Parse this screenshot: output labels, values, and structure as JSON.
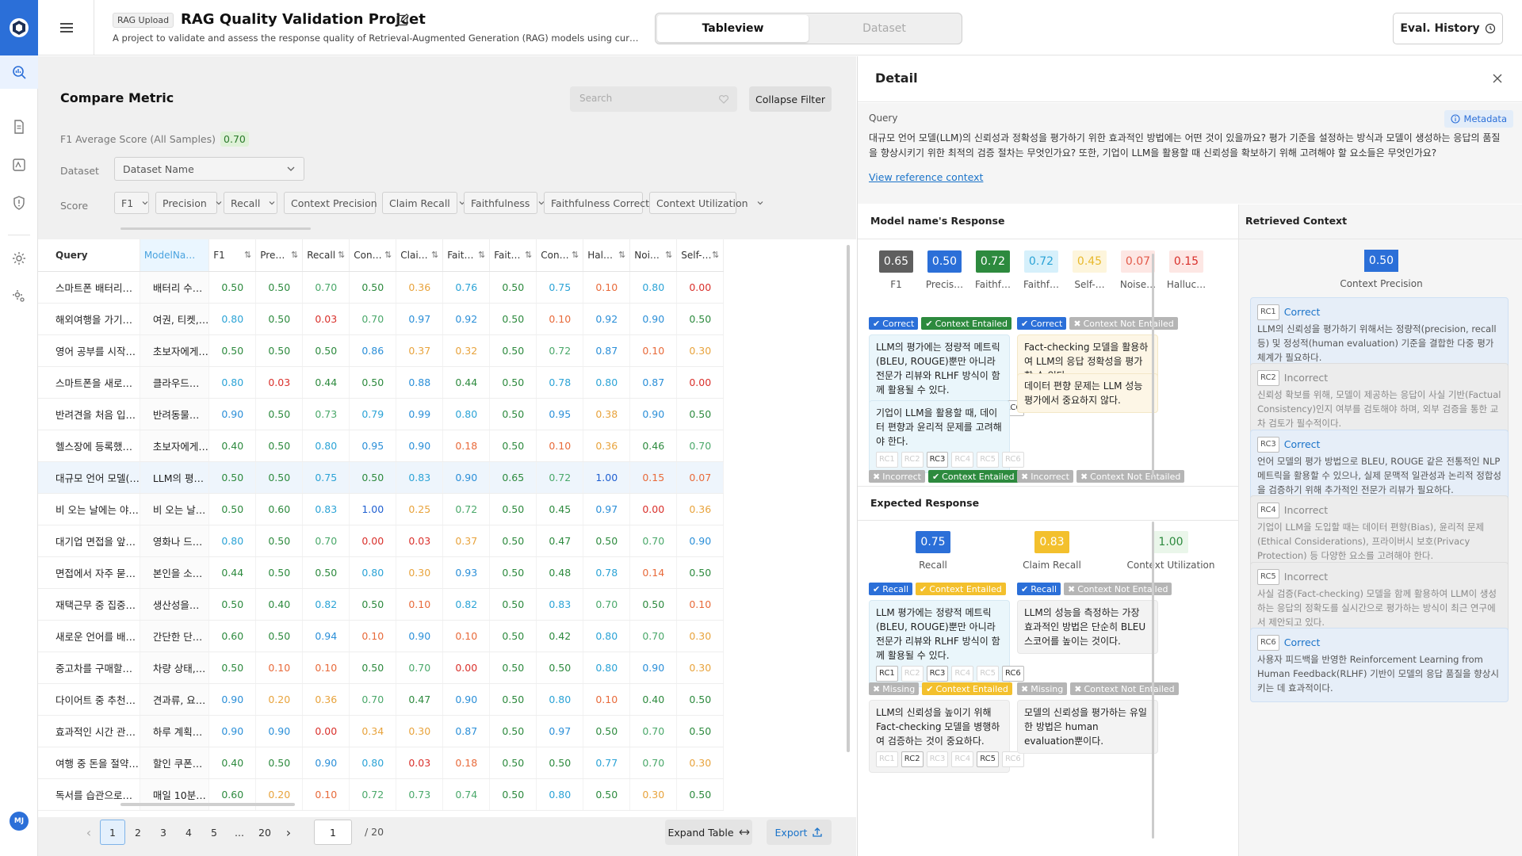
{
  "app": {
    "user_initials": "MJ"
  },
  "header": {
    "tag": "RAG Upload",
    "title": "RAG Quality Validation Projcet",
    "description": "A project to validate and assess the response quality of Retrieval-Augmented Generation (RAG) models using curated…",
    "tabs": [
      "Tableview",
      "Dataset"
    ],
    "eval_history": "Eval. History"
  },
  "compare": {
    "title": "Compare Metric",
    "search_placeholder": "Search",
    "collapse_filter": "Collapse Filter",
    "f1_label": "F1 Average Score (All Samples)",
    "f1_value": "0.70",
    "dataset_label": "Dataset",
    "dataset_value": "Dataset Name",
    "score_label": "Score",
    "filters": [
      "F1",
      "Precision",
      "Recall",
      "Context Precision",
      "Claim Recall",
      "Faithfulness",
      "Faithfulness Correct",
      "Context Utilization"
    ]
  },
  "table": {
    "headers": [
      "Query",
      "ModelNa…",
      "F1",
      "Pre…",
      "Recall",
      "Con…",
      "Clai…",
      "Fait…",
      "Fait…",
      "Con…",
      "Hal…",
      "Noi…",
      "Self-…"
    ],
    "rows": [
      {
        "q": "스마트폰 배터리…",
        "m": "배터리 수…",
        "v": [
          "0.50",
          "0.50",
          "0.70",
          "0.50",
          "0.36",
          "0.76",
          "0.50",
          "0.75",
          "0.10",
          "0.80",
          "0.00"
        ]
      },
      {
        "q": "해외여행을 가기…",
        "m": "여권, 티켓,…",
        "v": [
          "0.80",
          "0.50",
          "0.03",
          "0.70",
          "0.97",
          "0.92",
          "0.50",
          "0.10",
          "0.92",
          "0.90",
          "0.50"
        ]
      },
      {
        "q": "영어 공부를 시작…",
        "m": "초보자에게…",
        "v": [
          "0.50",
          "0.50",
          "0.50",
          "0.86",
          "0.37",
          "0.32",
          "0.50",
          "0.72",
          "0.87",
          "0.10",
          "0.30"
        ]
      },
      {
        "q": "스마트폰을 새로…",
        "m": "클라우드…",
        "v": [
          "0.80",
          "0.03",
          "0.44",
          "0.50",
          "0.88",
          "0.44",
          "0.50",
          "0.78",
          "0.80",
          "0.87",
          "0.00"
        ]
      },
      {
        "q": "반려견을 처음 입…",
        "m": "반려동물…",
        "v": [
          "0.90",
          "0.50",
          "0.73",
          "0.79",
          "0.99",
          "0.80",
          "0.50",
          "0.95",
          "0.38",
          "0.90",
          "0.50"
        ]
      },
      {
        "q": "헬스장에 등록했…",
        "m": "초보자에게…",
        "v": [
          "0.40",
          "0.50",
          "0.80",
          "0.95",
          "0.90",
          "0.18",
          "0.50",
          "0.10",
          "0.36",
          "0.46",
          "0.70"
        ]
      },
      {
        "q": "대규모 언어 모델(…",
        "m": "LLM의 평…",
        "v": [
          "0.50",
          "0.50",
          "0.75",
          "0.50",
          "0.83",
          "0.90",
          "0.65",
          "0.72",
          "1.00",
          "0.15",
          "0.07"
        ]
      },
      {
        "q": "비 오는 날에는 야…",
        "m": "비 오는 날…",
        "v": [
          "0.50",
          "0.60",
          "0.83",
          "1.00",
          "0.25",
          "0.72",
          "0.50",
          "0.45",
          "0.97",
          "0.00",
          "0.36"
        ]
      },
      {
        "q": "대기업 면접을 앞…",
        "m": "영화나 드…",
        "v": [
          "0.80",
          "0.50",
          "0.70",
          "0.00",
          "0.03",
          "0.37",
          "0.50",
          "0.47",
          "0.50",
          "0.70",
          "0.90"
        ]
      },
      {
        "q": "면접에서 자주 묻…",
        "m": "본인을 소…",
        "v": [
          "0.44",
          "0.50",
          "0.50",
          "0.80",
          "0.30",
          "0.93",
          "0.50",
          "0.48",
          "0.78",
          "0.14",
          "0.50"
        ]
      },
      {
        "q": "재택근무 중 집중…",
        "m": "생산성을…",
        "v": [
          "0.50",
          "0.40",
          "0.82",
          "0.50",
          "0.10",
          "0.82",
          "0.50",
          "0.83",
          "0.70",
          "0.50",
          "0.10"
        ]
      },
      {
        "q": "새로운 언어를 배…",
        "m": "간단한 단…",
        "v": [
          "0.60",
          "0.50",
          "0.94",
          "0.10",
          "0.90",
          "0.10",
          "0.50",
          "0.42",
          "0.80",
          "0.70",
          "0.30"
        ]
      },
      {
        "q": "중고차를 구매할…",
        "m": "차량 상태,…",
        "v": [
          "0.50",
          "0.10",
          "0.10",
          "0.50",
          "0.70",
          "0.00",
          "0.50",
          "0.50",
          "0.80",
          "0.90",
          "0.30"
        ]
      },
      {
        "q": "다이어트 중 추천…",
        "m": "견과류, 요…",
        "v": [
          "0.90",
          "0.20",
          "0.36",
          "0.70",
          "0.47",
          "0.90",
          "0.50",
          "0.80",
          "0.10",
          "0.40",
          "0.50"
        ]
      },
      {
        "q": "효과적인 시간 관…",
        "m": "하루 계획…",
        "v": [
          "0.90",
          "0.90",
          "0.00",
          "0.34",
          "0.30",
          "0.87",
          "0.50",
          "0.97",
          "0.50",
          "0.70",
          "0.50"
        ]
      },
      {
        "q": "여행 중 돈을 절약…",
        "m": "할인 쿠폰…",
        "v": [
          "0.40",
          "0.50",
          "0.90",
          "0.80",
          "0.03",
          "0.18",
          "0.50",
          "0.50",
          "0.77",
          "0.70",
          "0.30"
        ]
      },
      {
        "q": "독서를 습관으로…",
        "m": "매일 10분…",
        "v": [
          "0.60",
          "0.20",
          "0.10",
          "0.72",
          "0.73",
          "0.74",
          "0.50",
          "0.80",
          "0.50",
          "0.30",
          "0.50"
        ]
      }
    ]
  },
  "pagination": {
    "pages": [
      "1",
      "2",
      "3",
      "4",
      "5",
      "...",
      "20"
    ],
    "current": "1",
    "total": "/ 20",
    "expand": "Expand Table",
    "export": "Export"
  },
  "detail": {
    "title": "Detail",
    "query_label": "Query",
    "metadata": "Metadata",
    "query_text": "대규모 언어 모델(LLM)의 신뢰성과 정확성을 평가하기 위한 효과적인 방법에는 어떤 것이 있을까요? 평가 기준을 설정하는 방식과 모델이 생성하는 응답의 품질을 향상시키기 위한 최적의 검증 절차는 무엇인가요? 또한, 기업이 LLM을 활용할 때 신뢰성을 확보하기 위해 고려해야 할 요소들은 무엇인가요?",
    "view_ref": "View reference context",
    "model_resp_title": "Model name's Response",
    "model_metrics": [
      {
        "v": "0.65",
        "n": "F1",
        "bg": "#5f5f5f",
        "fg": "#ffffff"
      },
      {
        "v": "0.50",
        "n": "Precis…",
        "bg": "#2b6fd8",
        "fg": "#ffffff"
      },
      {
        "v": "0.72",
        "n": "Faithf…",
        "bg": "#2d8a3e",
        "fg": "#ffffff"
      },
      {
        "v": "0.72",
        "n": "Faithf…",
        "bg": "#d6f0fb",
        "fg": "#2ba3d6"
      },
      {
        "v": "0.45",
        "n": "Self-…",
        "bg": "#fdf5dc",
        "fg": "#e8b92c"
      },
      {
        "v": "0.07",
        "n": "Noise…",
        "bg": "#fde7e4",
        "fg": "#e35a4a"
      },
      {
        "v": "0.15",
        "n": "Halluc…",
        "bg": "#fde7e4",
        "fg": "#d9302b"
      }
    ],
    "tags": {
      "correct": "Correct",
      "incorrect": "Incorrect",
      "ctx_ent": "Context Entailed",
      "ctx_not": "Context Not Entailed",
      "recall": "Recall",
      "missing": "Missing"
    },
    "claims_left": [
      {
        "text": "LLM의 평가에는 정량적 메트릭(BLEU, ROUGE)뿐만 아니라 전문가 리뷰와 RLHF 방식이 함께 활용될 수 있다.",
        "rcs": [
          "RC1",
          "RC2",
          "RC3",
          "RC4",
          "RC5",
          "RC6"
        ]
      },
      {
        "text": "기업이 LLM을 활용할 때, 데이터 편향과 윤리적 문제를 고려해야 한다.",
        "rcs": [
          "RC1",
          "RC2",
          "RC3",
          "RC4",
          "RC5",
          "RC6"
        ]
      }
    ],
    "claims_right": [
      {
        "text": "Fact-checking 모델을 활용하여 LLM의 응답 정확성을 평가할 수 있다."
      },
      {
        "text": "데이터 편향 문제는 LLM 성능 평가에서 중요하지 않다."
      }
    ],
    "expected_title": "Expected Response",
    "expected_metrics": [
      {
        "v": "0.75",
        "n": "Recall",
        "bg": "#2b6fd8",
        "fg": "#ffffff"
      },
      {
        "v": "0.83",
        "n": "Claim Recall",
        "bg": "#f3c02d",
        "fg": "#ffffff"
      },
      {
        "v": "1.00",
        "n": "Context Utilization",
        "bg": "#eaf6ea",
        "fg": "#2d8a3e"
      }
    ],
    "exp_left": [
      {
        "text": "LLM 평가에는 정량적 메트릭(BLEU, ROUGE)뿐만 아니라 전문가 리뷰와 RLHF 방식이 함께 활용될 수 있다.",
        "rcs": [
          "RC1",
          "RC2",
          "RC3",
          "RC4",
          "RC5",
          "RC6"
        ]
      },
      {
        "text": "LLM의 신뢰성을 높이기 위해 Fact-checking 모델을 병행하여 검증하는 것이 중요하다.",
        "rcs": [
          "RC1",
          "RC2",
          "RC3",
          "RC4",
          "RC5",
          "RC6"
        ]
      }
    ],
    "exp_right": [
      {
        "text": "LLM의 성능을 측정하는 가장 효과적인 방법은 단순히 BLEU 스코어를 높이는 것이다."
      },
      {
        "text": "모델의 신뢰성을 평가하는 유일한 방법은 human evaluation뿐이다."
      }
    ],
    "retrieved_title": "Retrieved Context",
    "context_precision": {
      "v": "0.50",
      "n": "Context Precision"
    },
    "contexts": [
      {
        "id": "RC1",
        "label": "Correct",
        "ok": true,
        "text": "LLM의 신뢰성을 평가하기 위해서는 정량적(precision, recall 등) 및 정성적(human evaluation) 기준을 결합한 다중 평가 체계가 필요하다."
      },
      {
        "id": "RC2",
        "label": "Incorrect",
        "ok": false,
        "text": "신뢰성 확보를 위해, 모델이 제공하는 응답이 사실 기반(Factual Consistency)인지 여부를 검토해야 하며, 외부 검증을 통한 교차 검토가 필수적이다."
      },
      {
        "id": "RC3",
        "label": "Correct",
        "ok": true,
        "text": "언어 모델의 평가 방법으로 BLEU, ROUGE 같은 전통적인 NLP 메트릭을 활용할 수 있으나, 실제 문맥적 일관성과 논리적 정합성을 검증하기 위해 추가적인 전문가 리뷰가 필요하다."
      },
      {
        "id": "RC4",
        "label": "Incorrect",
        "ok": false,
        "text": "기업이 LLM을 도입할 때는 데이터 편향(Bias), 윤리적 문제(Ethical Considerations), 프라이버시 보호(Privacy Protection) 등 다양한 요소를 고려해야 한다."
      },
      {
        "id": "RC5",
        "label": "Incorrect",
        "ok": false,
        "text": "사실 검증(Fact-checking) 모델을 함께 활용하여 LLM이 생성하는 응답의 정확도를 실시간으로 평가하는 방식이 최근 연구에서 제안되고 있다."
      },
      {
        "id": "RC6",
        "label": "Correct",
        "ok": true,
        "text": "사용자 피드백을 반영한 Reinforcement Learning from Human Feedback(RLHF) 기반이 모델의 응답 품질을 향상시키는 데 효과적이다."
      }
    ]
  },
  "colors": {
    "green": "#2d8a3e",
    "blue": "#2b6fd8",
    "red": "#d9302b",
    "orange": "#e8a33c",
    "gray": "#999999"
  }
}
